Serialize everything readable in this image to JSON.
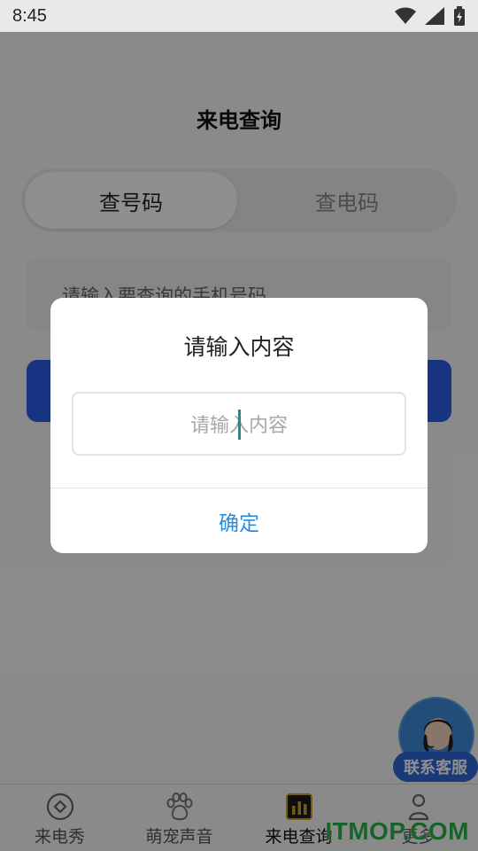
{
  "status_bar": {
    "time": "8:45",
    "icons": [
      "wifi-icon",
      "signal-icon",
      "battery-icon"
    ]
  },
  "page": {
    "title": "来电查询",
    "tabs": [
      {
        "label": "查号码",
        "active": true
      },
      {
        "label": "查电码",
        "active": false
      }
    ],
    "phone_input_placeholder": "请输入要查询的手机号码",
    "query_button_color": "#2d5bea"
  },
  "floating_service": {
    "label": "联系客服",
    "icon": "customer-service-avatar"
  },
  "bottom_nav": {
    "items": [
      {
        "label": "来电秀",
        "icon": "circle-dot-icon",
        "active": false
      },
      {
        "label": "萌宠声音",
        "icon": "paw-icon",
        "active": false
      },
      {
        "label": "来电查询",
        "icon": "bar-chart-icon",
        "active": true
      },
      {
        "label": "更多",
        "icon": "person-icon",
        "active": false
      }
    ]
  },
  "watermark": "ITMOP.COM",
  "dialog": {
    "title": "请输入内容",
    "input_placeholder": "请输入内容",
    "confirm_label": "确定",
    "accent_color": "#2a8de0"
  }
}
